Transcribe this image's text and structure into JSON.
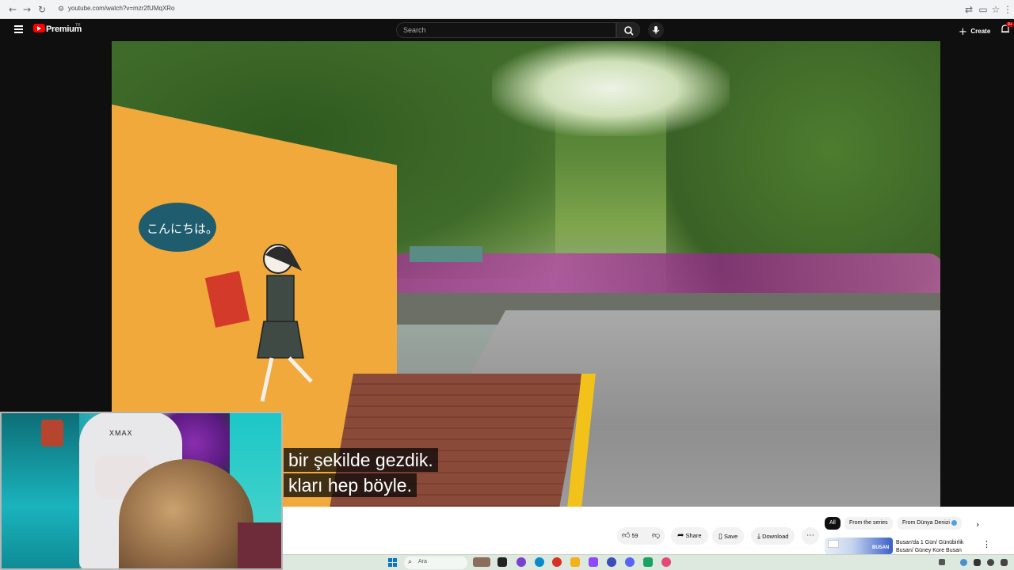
{
  "browser": {
    "url": "youtube.com/watch?v=mzr2fUMqXRo",
    "nav_icons": [
      "back-arrow-icon",
      "forward-arrow-icon",
      "reload-icon",
      "site-info-icon"
    ],
    "right_icons": [
      "translate-icon",
      "cast-icon",
      "bookmark-star-icon",
      "extensions-icon"
    ]
  },
  "youtube": {
    "logo_text": "Premium",
    "logo_superscript": "TR",
    "search_placeholder": "Search",
    "create_label": "Create",
    "notification_badge": "9+"
  },
  "video": {
    "bubble_text": "こんにちは。",
    "subtitles": [
      "bir şekilde gezdik.",
      "kları hep böyle."
    ]
  },
  "webcam": {
    "chair_brand": "XMAX"
  },
  "actions": {
    "like_count": "59",
    "share_label": "Share",
    "save_label": "Save",
    "download_label": "Download"
  },
  "chips": [
    {
      "label": "All",
      "active": true
    },
    {
      "label": "From the series",
      "active": false
    },
    {
      "label": "From Dünya Denizi",
      "active": false
    }
  ],
  "recommendation": {
    "title": "Busan'da 1 Gün/ Günübirlik Busan/ Güney Kore Busan",
    "thumb_text": "BUSAN"
  },
  "taskbar": {
    "search_text": "Ara"
  }
}
